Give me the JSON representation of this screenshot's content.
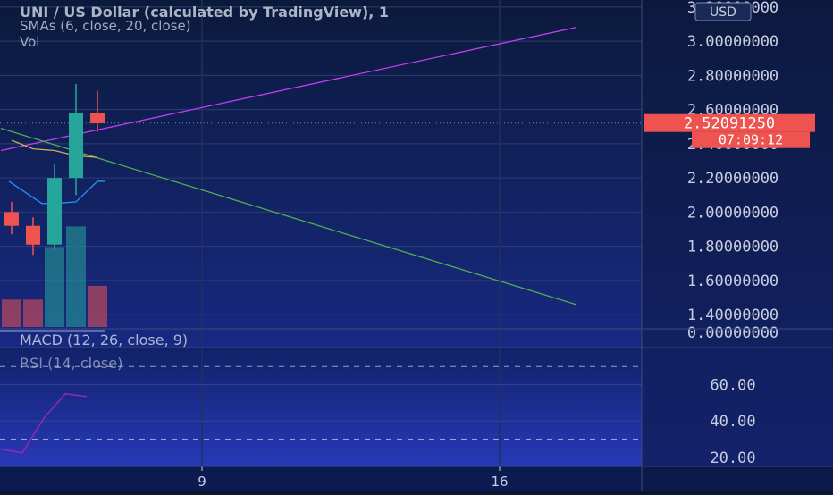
{
  "header": {
    "title": "UNI / US Dollar (calculated by TradingView), 1",
    "sma_label": "SMAs (6, close, 20, close)",
    "vol_label": "Vol",
    "currency_button": "USD"
  },
  "price_badge": {
    "price": "2.52091250",
    "countdown": "07:09:12"
  },
  "indicators": {
    "macd_label": "MACD (12, 26, close, 9)",
    "rsi_label": "RSI (14, close)"
  },
  "colors": {
    "background_top": "#0b1a3a",
    "background_bottom": "#1d2fa0",
    "up": "#26a69a",
    "down": "#ef5350",
    "sma6": "#2196f3",
    "sma20": "#c9b458",
    "trend_up": "#c13df2",
    "trend_down": "#4caf50",
    "rsi": "#9c27b0",
    "axis_text": "#c8cde0"
  },
  "chart_data": {
    "type": "candlestick",
    "title": "UNI / US Dollar (calculated by TradingView), 1",
    "price_axis": {
      "ticks": [
        "3.20000000",
        "3.00000000",
        "2.80000000",
        "2.60000000",
        "2.40000000",
        "2.20000000",
        "2.00000000",
        "1.80000000",
        "1.60000000",
        "1.40000000"
      ],
      "ylim": [
        1.38,
        3.22
      ]
    },
    "x_axis": {
      "ticks": [
        "9",
        "16"
      ]
    },
    "candles": [
      {
        "open": 2.0,
        "high": 2.06,
        "low": 1.87,
        "close": 1.92
      },
      {
        "open": 1.92,
        "high": 1.97,
        "low": 1.75,
        "close": 1.81
      },
      {
        "open": 1.81,
        "high": 2.28,
        "low": 1.78,
        "close": 2.2
      },
      {
        "open": 2.2,
        "high": 2.75,
        "low": 2.1,
        "close": 2.58
      },
      {
        "open": 2.58,
        "high": 2.71,
        "low": 2.47,
        "close": 2.52
      }
    ],
    "sma6": [
      null,
      null,
      2.05,
      2.06,
      2.18
    ],
    "sma20_path": [
      [
        0,
        2.42
      ],
      [
        1,
        2.37
      ],
      [
        2,
        2.36
      ],
      [
        3,
        2.33
      ],
      [
        4,
        2.32
      ]
    ],
    "trendlines": [
      {
        "name": "",
        "from": [
          -0.5,
          2.36
        ],
        "to": [
          26.3,
          3.08
        ]
      },
      {
        "name": "",
        "from": [
          -0.5,
          2.49
        ],
        "to": [
          26.3,
          1.46
        ]
      }
    ],
    "current_price": 2.5209125,
    "volume": {
      "values": [
        24,
        24,
        70,
        88,
        36
      ],
      "colors": [
        "down",
        "down",
        "up",
        "up",
        "down"
      ],
      "vmax": 100
    },
    "macd": {
      "label": "MACD (12, 26, close, 9)",
      "ticks": [
        "0.00000000"
      ]
    },
    "rsi": {
      "label": "RSI (14, close)",
      "ticks": [
        "60.00",
        "40.00",
        "20.00"
      ],
      "ylim": [
        15,
        80
      ],
      "bands": [
        70,
        30
      ],
      "points": [
        [
          -0.5,
          24.5
        ],
        [
          0.5,
          22.5
        ],
        [
          1.5,
          41.5
        ],
        [
          2.5,
          55
        ],
        [
          3.5,
          53.5
        ]
      ]
    }
  }
}
